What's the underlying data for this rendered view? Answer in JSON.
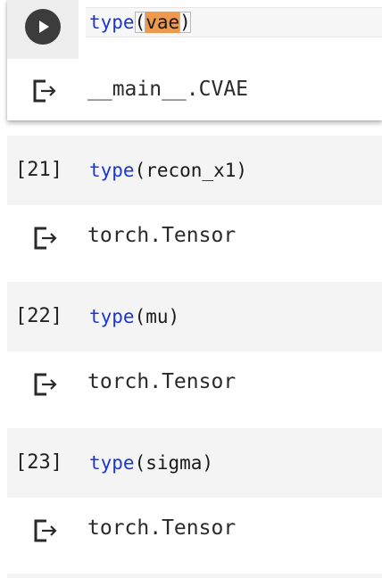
{
  "cells": [
    {
      "active": true,
      "code": {
        "fn": "type",
        "open": "(",
        "arg": "vae",
        "close": ")"
      },
      "output": "__main__.CVAE"
    },
    {
      "exec_count": "[21]",
      "code": {
        "fn": "type",
        "rest": "(recon_x1)"
      },
      "output": "torch.Tensor"
    },
    {
      "exec_count": "[22]",
      "code": {
        "fn": "type",
        "rest": "(mu)"
      },
      "output": "torch.Tensor"
    },
    {
      "exec_count": "[23]",
      "code": {
        "fn": "type",
        "rest": "(sigma)"
      },
      "output": "torch.Tensor"
    }
  ],
  "icons": {
    "run": "play-icon",
    "output": "output-arrow-icon"
  },
  "colors": {
    "keyword": "#1a36d4",
    "selection_highlight": "#ee9a4e",
    "cell_background": "#f4f4f4",
    "run_button": "#3c3c3c"
  }
}
